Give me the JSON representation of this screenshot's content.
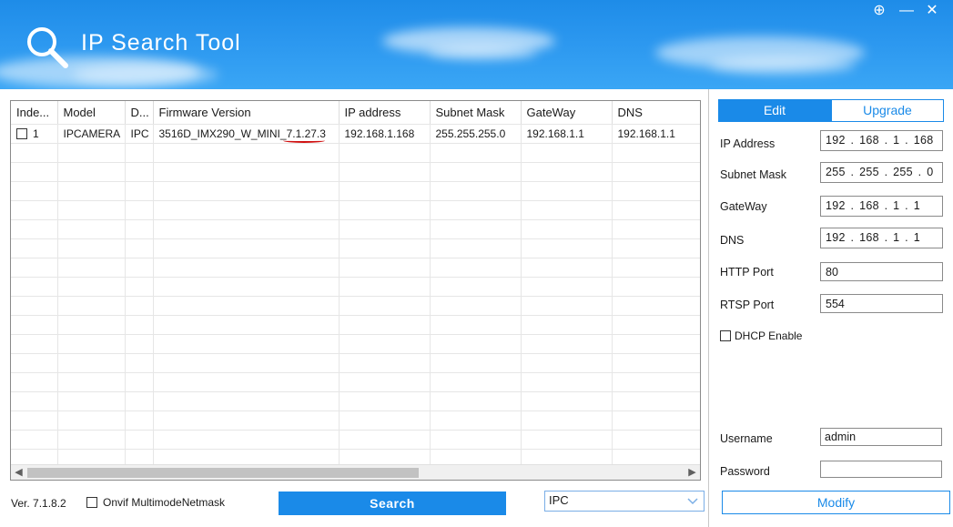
{
  "app": {
    "title": "IP Search Tool"
  },
  "window_buttons": {
    "add": "⊕",
    "minimize": "—",
    "close": "✕"
  },
  "grid": {
    "columns": [
      "Inde...",
      "Model",
      "D...",
      "Firmware Version",
      "IP address",
      "Subnet Mask",
      "GateWay",
      "DNS"
    ],
    "rows": [
      {
        "index": "1",
        "model": "IPCAMERA",
        "device": "IPC",
        "firmware": "3516D_IMX290_W_MINI_7.1.27.3",
        "ip": "192.168.1.168",
        "mask": "255.255.255.0",
        "gateway": "192.168.1.1",
        "dns": "192.168.1.1"
      }
    ]
  },
  "bottom": {
    "version": "Ver. 7.1.8.2",
    "onvif_label": "Onvif MultimodeNetmask",
    "search_label": "Search",
    "type_selected": "IPC"
  },
  "panel": {
    "tab_edit": "Edit",
    "tab_upgrade": "Upgrade",
    "fields": {
      "ip_label": "IP Address",
      "ip_value": "192 . 168 .  1  . 168",
      "mask_label": "Subnet Mask",
      "mask_value": "255 . 255 . 255 .  0",
      "gw_label": "GateWay",
      "gw_value": "192 . 168 .  1  .  1",
      "dns_label": "DNS",
      "dns_value": "192 . 168 .  1  .  1",
      "http_label": "HTTP Port",
      "http_value": "80",
      "rtsp_label": "RTSP Port",
      "rtsp_value": "554",
      "dhcp_label": "DHCP Enable",
      "user_label": "Username",
      "user_value": "admin",
      "pass_label": "Password",
      "pass_value": ""
    },
    "modify_label": "Modify"
  },
  "colors": {
    "accent": "#1a8ae8",
    "header": "#2b97ef",
    "annotation": "#d01010"
  }
}
